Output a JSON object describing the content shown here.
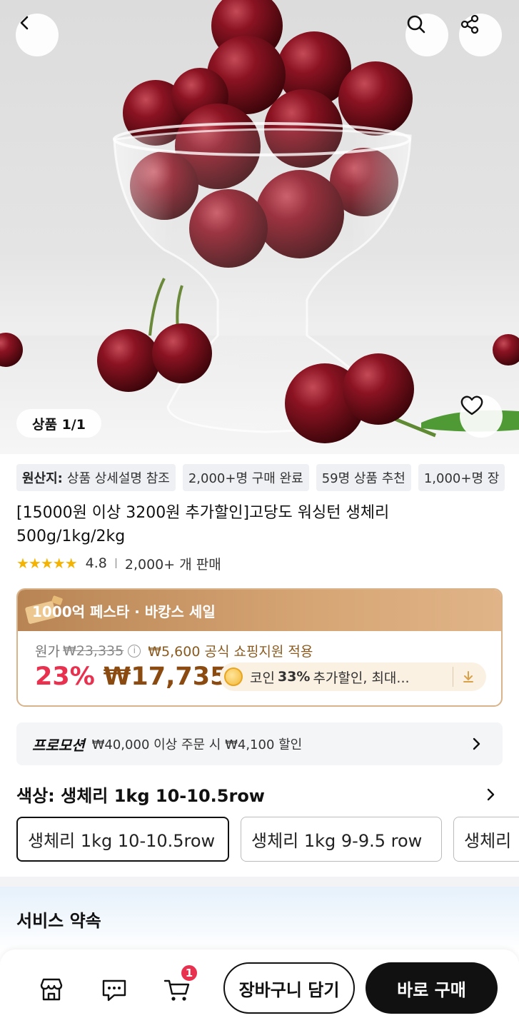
{
  "hero": {
    "image_subject": "cherries in glass dessert bowl",
    "counter": "상품 1/1"
  },
  "icons": {
    "back": "back-arrow-icon",
    "search": "search-icon",
    "share": "share-icon",
    "like": "heart-icon"
  },
  "chips": [
    {
      "label": "원산지:",
      "value": "상품 상세설명 참조"
    },
    {
      "value": "2,000+명 구매 완료"
    },
    {
      "value": "59명 상품 추천"
    },
    {
      "value": "1,000+명 장"
    }
  ],
  "product": {
    "title": "[15000원 이상 3200원 추가할인]고당도 워싱턴 생체리 500g/1kg/2kg",
    "rating": "4.8",
    "stars": 5,
    "sold": "2,000+ 개 판매"
  },
  "price": {
    "event": "1000억 페스타 · 바캉스 세일",
    "original_label": "원가",
    "original_price": "₩23,335",
    "support": "₩5,600 공식 쇼핑지원 적용",
    "discount": "23%",
    "sale_price": "₩17,735",
    "coin_prefix": "코인",
    "coin_rate": "33%",
    "coin_suffix": "추가할인, 최대..."
  },
  "promotion": {
    "tag": "프로모션",
    "text": "₩40,000 이상 주문 시 ₩4,100 할인"
  },
  "color": {
    "label": "색상: 생체리 1kg 10-10.5row",
    "options": [
      "생체리 1kg 10-10.5row",
      "생체리 1kg 9-9.5 row",
      "생체리"
    ],
    "selected_index": 0
  },
  "service": {
    "title": "서비스 약속"
  },
  "bottom": {
    "cart_badge": "1",
    "add_to_cart": "장바구니 담기",
    "buy_now": "바로 구매"
  },
  "colors": {
    "discount_red": "#e8314f",
    "price_brown": "#8a4a10",
    "star_yellow": "#f5b301",
    "festa_bar": "#c9966a",
    "buy_button": "#111111"
  }
}
